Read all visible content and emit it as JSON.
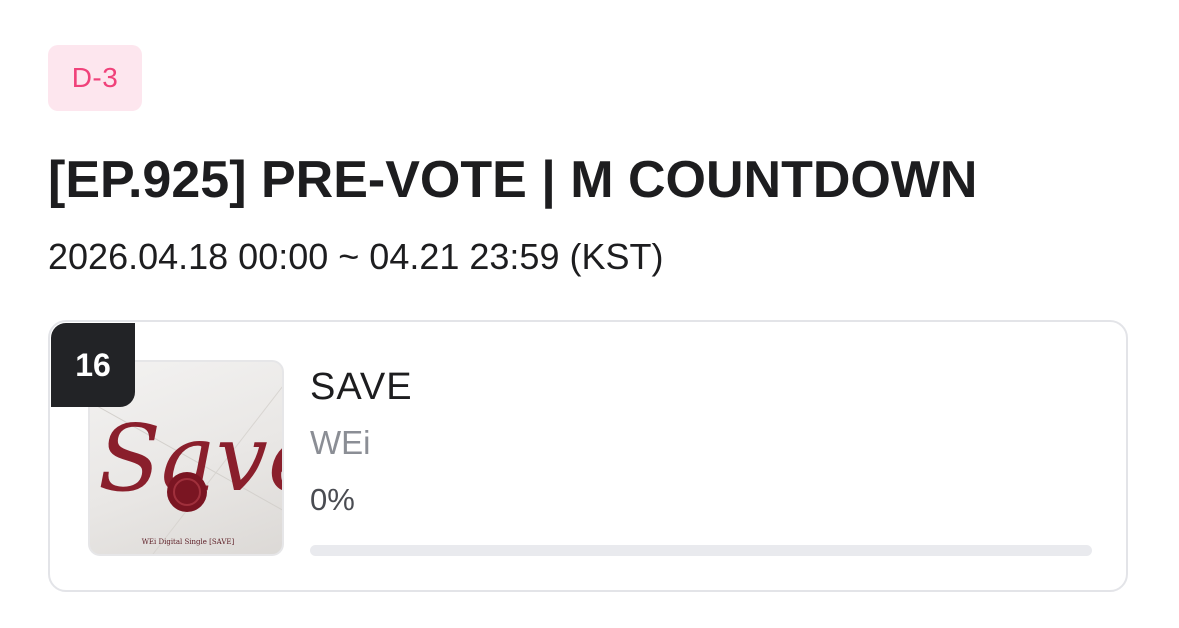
{
  "badge": {
    "dday": "D-3"
  },
  "header": {
    "title": "[EP.925] PRE-VOTE | M COUNTDOWN",
    "period": "2026.04.18 00:00 ~ 04.21 23:59 (KST)"
  },
  "candidate": {
    "rank": "16",
    "song": "SAVE",
    "artist": "WEi",
    "percent_label": "0%",
    "vote_fraction": 0,
    "cover": {
      "script_text": "Save",
      "caption": "WEi Digital Single [SAVE]",
      "script_color": "#8a1f2c",
      "seal_color": "#7a1522"
    }
  },
  "colors": {
    "accent": "#f0427a",
    "badge_bg": "#fde6ee",
    "rank_bg": "#222326",
    "progress_track": "#e9eaee"
  }
}
